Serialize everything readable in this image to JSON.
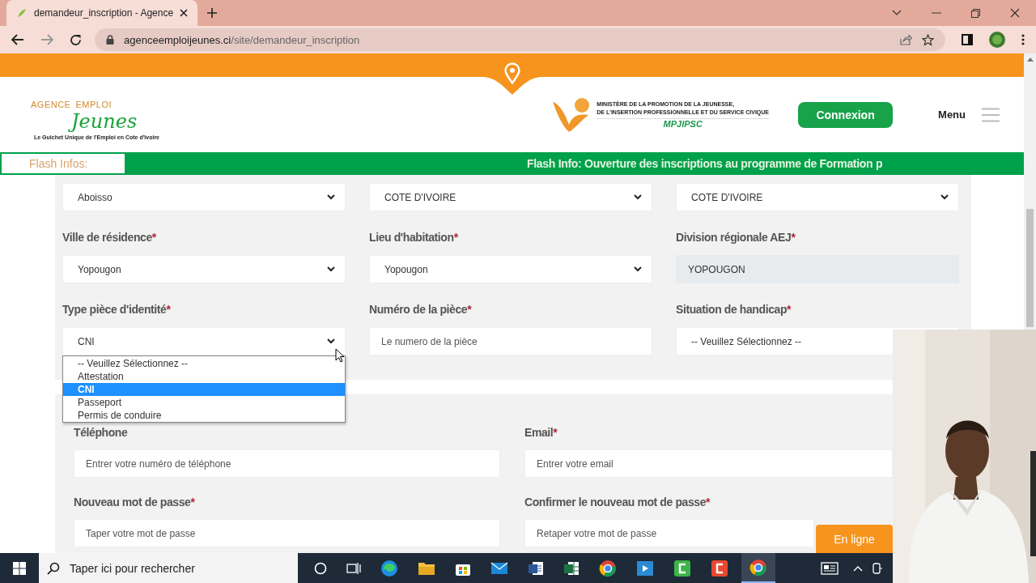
{
  "browser": {
    "tab_title": "demandeur_inscription - Agence",
    "url_host": "agenceemploijeunes.ci",
    "url_path": "/site/demandeur_inscription"
  },
  "header": {
    "logo_top_left": "AGENCE",
    "logo_top_right": "EMPLOI",
    "logo_main": "Jeunes",
    "logo_tagline": "Le Guichet Unique de l'Emploi en Cote d'Ivoire",
    "ministry_lines": [
      "MINISTÈRE DE LA PROMOTION DE LA JEUNESSE,",
      "DE L'INSERTION PROFESSIONNELLE ET DU SERVICE CIVIQUE"
    ],
    "ministry_acronym": "MPJIPSC",
    "login_button": "Connexion",
    "menu_label": "Menu"
  },
  "flash": {
    "label": "Flash Infos:",
    "text": "Flash Info: Ouverture des inscriptions au programme de Formation p"
  },
  "form_rows": [
    [
      {
        "kind": "select",
        "value": "Aboisso"
      },
      {
        "kind": "select",
        "value": "COTE D'IVOIRE"
      },
      {
        "kind": "select",
        "value": "COTE D'IVOIRE"
      }
    ],
    [
      {
        "label": "Ville de résidence",
        "required_mark": "*",
        "kind": "select",
        "value": "Yopougon"
      },
      {
        "label": "Lieu d'habitation",
        "required_mark": "*",
        "kind": "select",
        "value": "Yopougon"
      },
      {
        "label": "Division régionale AEJ",
        "required_mark": "*",
        "kind": "readonly",
        "value": "YOPOUGON"
      }
    ],
    [
      {
        "label": "Type pièce d'identité",
        "required_mark": "*",
        "kind": "select",
        "value": "CNI",
        "open": true,
        "options": [
          {
            "label": "-- Veuillez Sélectionnez --",
            "selected": false
          },
          {
            "label": "Attestation",
            "selected": false
          },
          {
            "label": "CNI",
            "selected": true
          },
          {
            "label": "Passeport",
            "selected": false
          },
          {
            "label": "Permis de conduire",
            "selected": false
          }
        ]
      },
      {
        "label": "Numéro de la pièce",
        "required_mark": "*",
        "kind": "input",
        "placeholder": "Le numero de la pièce"
      },
      {
        "label": "Situation de handicap",
        "required_mark": "*",
        "kind": "select",
        "value": "-- Veuillez Sélectionnez --"
      }
    ]
  ],
  "account_rows": [
    [
      {
        "label": "Téléphone",
        "kind": "input",
        "placeholder": "Entrer votre numéro de téléphone"
      },
      {
        "label": "Email",
        "required_mark": "*",
        "kind": "input",
        "placeholder": "Entrer votre email"
      }
    ],
    [
      {
        "label": "Nouveau mot de passe",
        "required_mark": "*",
        "kind": "input",
        "placeholder": "Taper votre mot de passe"
      },
      {
        "label": "Confirmer le nouveau mot de passe",
        "required_mark": "*",
        "kind": "input",
        "placeholder": "Retaper votre mot de passe"
      }
    ]
  ],
  "chat_button": "En ligne",
  "taskbar": {
    "search_placeholder": "Taper ici pour rechercher"
  },
  "webcam": {
    "kind": "picture"
  }
}
